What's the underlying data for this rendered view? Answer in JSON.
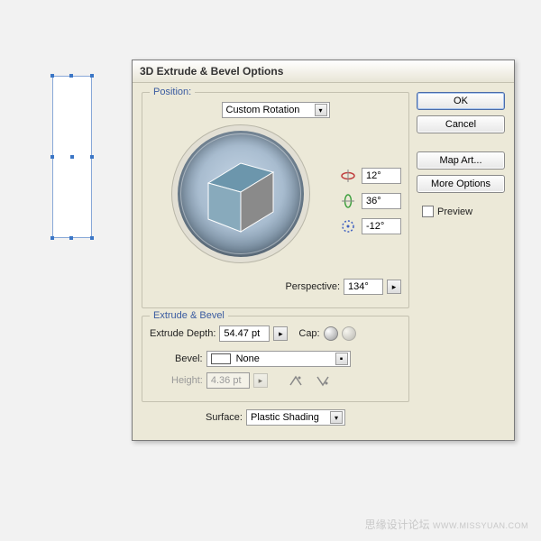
{
  "dialog": {
    "title": "3D Extrude & Bevel Options",
    "position": {
      "label": "Position:",
      "value": "Custom Rotation",
      "rotation_x": "12°",
      "rotation_y": "36°",
      "rotation_z": "-12°",
      "perspective_label": "Perspective:",
      "perspective_value": "134°"
    },
    "extrude": {
      "legend": "Extrude & Bevel",
      "depth_label": "Extrude Depth:",
      "depth_value": "54.47 pt",
      "cap_label": "Cap:",
      "bevel_label": "Bevel:",
      "bevel_value": "None",
      "height_label": "Height:",
      "height_value": "4.36 pt"
    },
    "surface": {
      "label": "Surface:",
      "value": "Plastic Shading"
    },
    "buttons": {
      "ok": "OK",
      "cancel": "Cancel",
      "map_art": "Map Art...",
      "more_options": "More Options",
      "preview": "Preview"
    }
  },
  "icons": {
    "dropdown": "▾",
    "play": "▸"
  },
  "watermark": {
    "cn": "思缘设计论坛",
    "en": "WWW.MISSYUAN.COM"
  }
}
